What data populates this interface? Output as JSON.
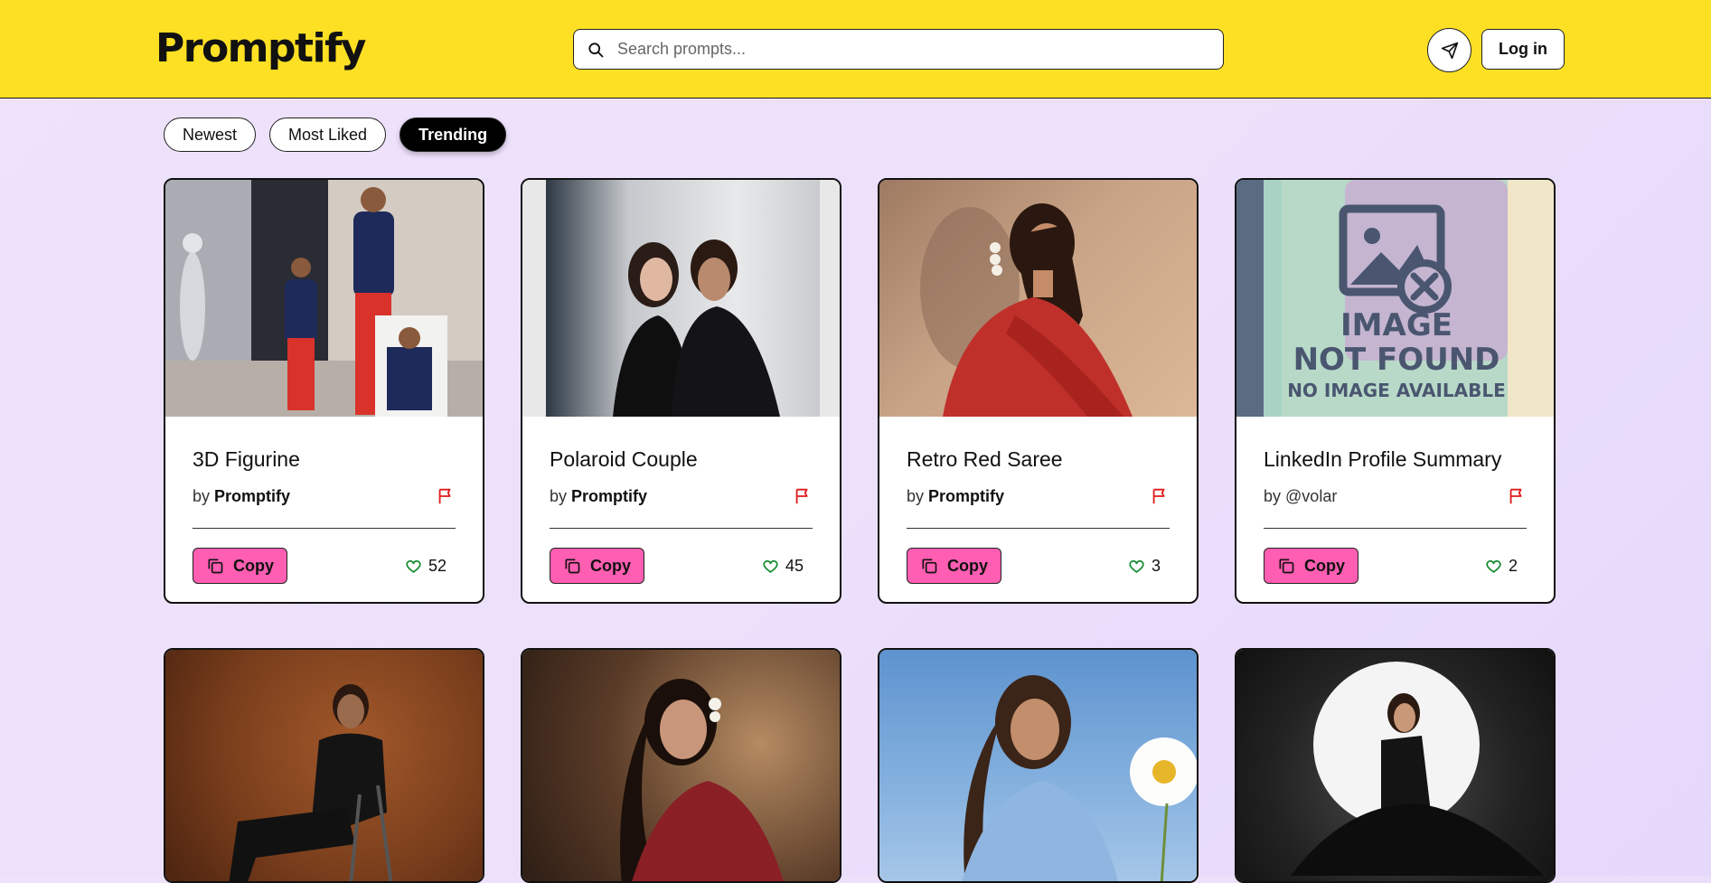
{
  "app": {
    "logo": "Promptify"
  },
  "search": {
    "placeholder": "Search prompts..."
  },
  "header": {
    "login_label": "Log in"
  },
  "filters": [
    {
      "label": "Newest",
      "active": false
    },
    {
      "label": "Most Liked",
      "active": false
    },
    {
      "label": "Trending",
      "active": true
    }
  ],
  "card_actions": {
    "copy_label": "Copy",
    "by_prefix": "by"
  },
  "cards": [
    {
      "title": "3D Figurine",
      "author": "Promptify",
      "author_bold": true,
      "likes": "52",
      "image": "cricketer-figurine-photo"
    },
    {
      "title": "Polaroid Couple",
      "author": "Promptify",
      "author_bold": true,
      "likes": "45",
      "image": "couple-polaroid-photo"
    },
    {
      "title": "Retro Red Saree",
      "author": "Promptify",
      "author_bold": true,
      "likes": "3",
      "image": "woman-red-saree-photo"
    },
    {
      "title": "LinkedIn Profile Summary",
      "author": "@volar",
      "author_bold": false,
      "likes": "2",
      "image": "image-not-found-placeholder"
    },
    {
      "image": "man-seated-brown-backdrop-photo"
    },
    {
      "image": "woman-maroon-saree-photo"
    },
    {
      "image": "woman-blue-sweater-daisy-photo"
    },
    {
      "image": "woman-black-gown-spotlight-photo"
    }
  ],
  "placeholder_image": {
    "line1": "IMAGE",
    "line2": "NOT FOUND",
    "line3": "NO IMAGE AVAILABLE"
  },
  "colors": {
    "header": "#fde024",
    "accent_pink": "#ff5eb2",
    "flag_red": "#e01b1b",
    "heart_green": "#138a2e"
  }
}
